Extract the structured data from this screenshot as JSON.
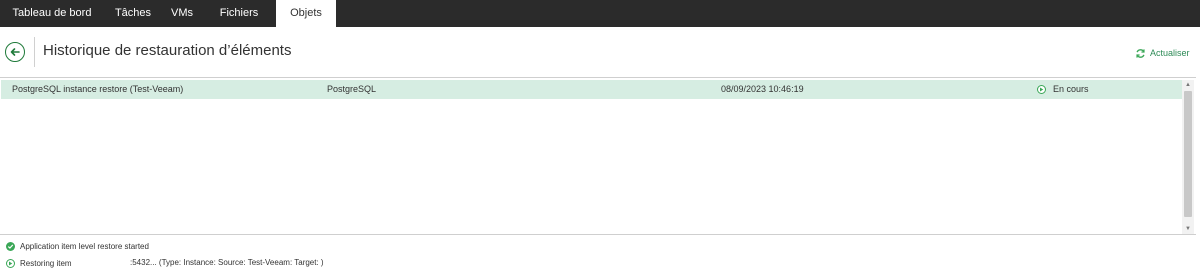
{
  "nav": {
    "tabs": [
      {
        "label": "Tableau de bord"
      },
      {
        "label": "Tâches"
      },
      {
        "label": "VMs"
      },
      {
        "label": "Fichiers"
      },
      {
        "label": "Objets",
        "active": true
      }
    ]
  },
  "header": {
    "title": "Historique de restauration d’éléments",
    "back_icon": "back-arrow-icon",
    "refresh_label": "Actualiser",
    "refresh_icon": "refresh-icon"
  },
  "grid": {
    "rows": [
      {
        "name": "PostgreSQL instance restore (Test-Veeam)",
        "type": "PostgreSQL",
        "time": "08/09/2023 10:46:19",
        "status": "En cours",
        "status_icon": "play-circle-icon"
      }
    ]
  },
  "log": [
    {
      "text": "Application item level restore started",
      "icon": "check-circle-icon"
    },
    {
      "text": "Restoring item",
      "detail": ":5432... (Type: Instance: Source: Test-Veeam: Target:                    )",
      "icon": "play-circle-icon"
    }
  ],
  "colors": {
    "nav_bg": "#2b2b2b",
    "accent": "#2e8b57",
    "row_selected": "#d6ede2",
    "status_green": "#3aa757"
  }
}
